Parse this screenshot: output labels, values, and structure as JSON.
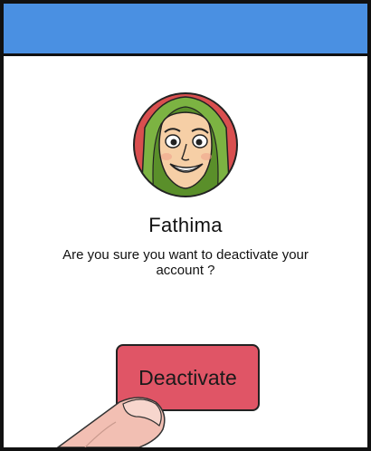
{
  "header": {
    "color": "#4a90e2"
  },
  "profile": {
    "avatar_icon": "user-avatar-woman-hijab",
    "name": "Fathima"
  },
  "dialog": {
    "message": "Are you sure you want to deactivate your account ?"
  },
  "actions": {
    "deactivate_label": "Deactivate",
    "deactivate_color": "#e05566"
  },
  "decor": {
    "hand_icon": "finger-tap-icon"
  }
}
